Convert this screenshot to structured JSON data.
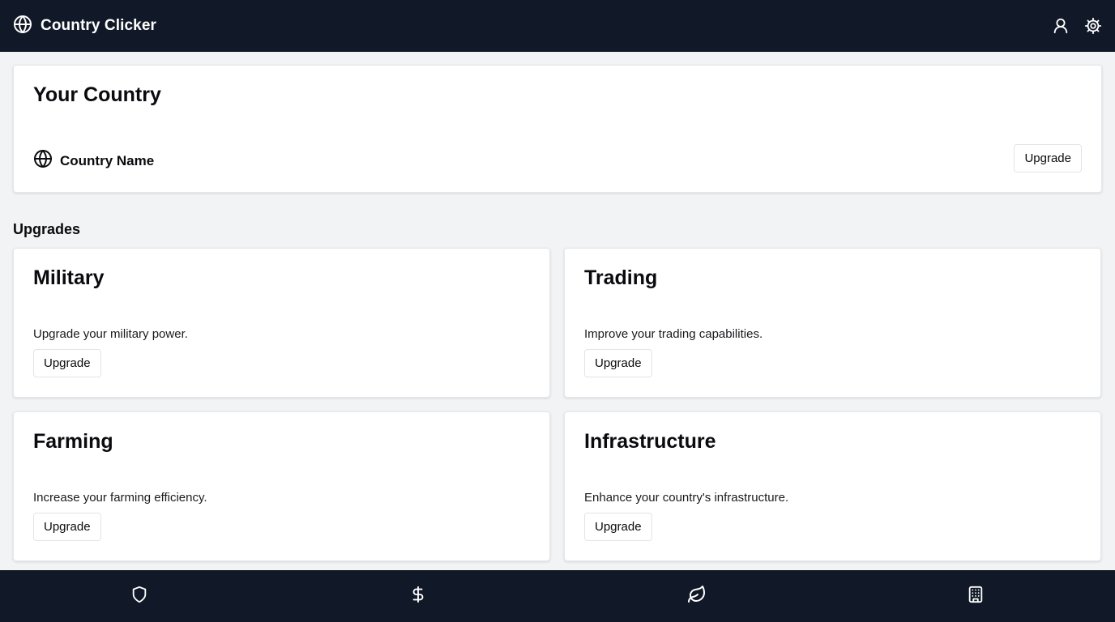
{
  "app": {
    "title": "Country Clicker",
    "logo_icon": "globe-icon"
  },
  "header": {
    "actions": [
      {
        "icon": "user-icon"
      },
      {
        "icon": "settings-icon"
      }
    ]
  },
  "country": {
    "title": "Your Country",
    "name": "Country Name",
    "icon": "globe-icon",
    "upgrade_label": "Upgrade"
  },
  "upgrades": {
    "section_title": "Upgrades",
    "items": [
      {
        "title": "Military",
        "description": "Upgrade your military power.",
        "button": "Upgrade"
      },
      {
        "title": "Trading",
        "description": "Improve your trading capabilities.",
        "button": "Upgrade"
      },
      {
        "title": "Farming",
        "description": "Increase your farming efficiency.",
        "button": "Upgrade"
      },
      {
        "title": "Infrastructure",
        "description": "Enhance your country's infrastructure.",
        "button": "Upgrade"
      }
    ]
  },
  "bottom_nav": [
    {
      "icon": "shield-icon"
    },
    {
      "icon": "dollar-icon"
    },
    {
      "icon": "leaf-icon"
    },
    {
      "icon": "building-icon"
    }
  ],
  "colors": {
    "bar_background": "#111827",
    "page_background": "#f2f3f5",
    "card_background": "#ffffff"
  }
}
